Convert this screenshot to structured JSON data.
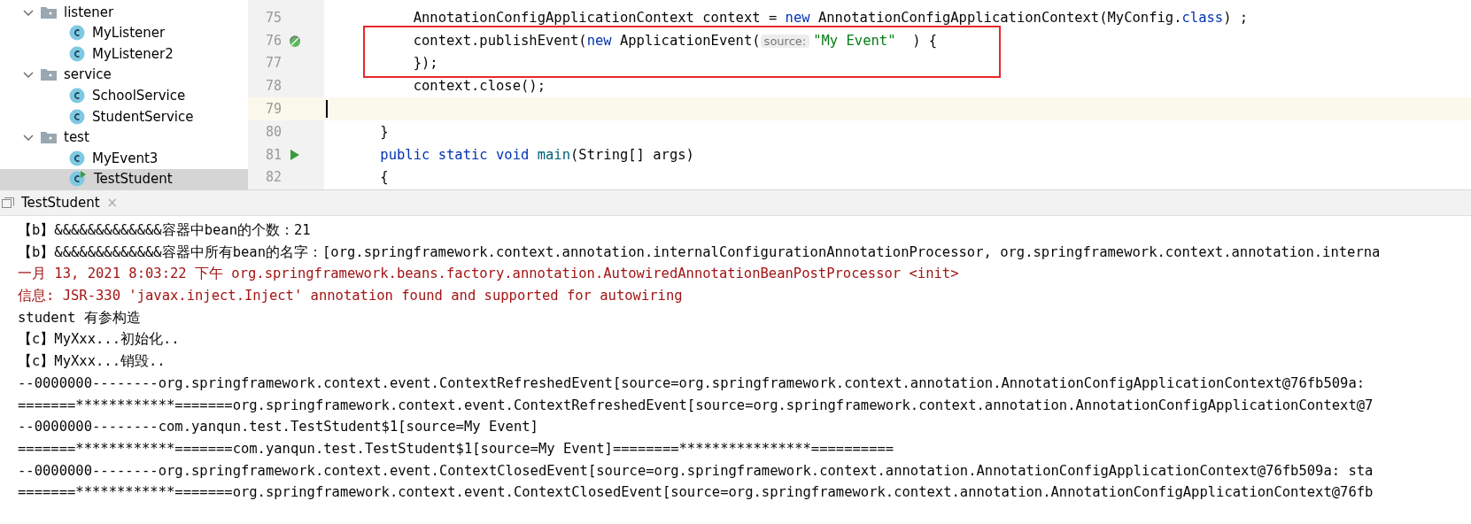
{
  "project_tree": {
    "items": [
      {
        "label": "listener",
        "kind": "folder",
        "expanded": true,
        "selected": false,
        "children": [
          {
            "label": "MyListener",
            "kind": "class",
            "selected": false
          },
          {
            "label": "MyListener2",
            "kind": "class",
            "selected": false
          }
        ]
      },
      {
        "label": "service",
        "kind": "folder",
        "expanded": true,
        "selected": false,
        "children": [
          {
            "label": "SchoolService",
            "kind": "class",
            "selected": false
          },
          {
            "label": "StudentService",
            "kind": "class",
            "selected": false
          }
        ]
      },
      {
        "label": "test",
        "kind": "folder",
        "expanded": true,
        "selected": false,
        "children": [
          {
            "label": "MyEvent3",
            "kind": "class",
            "selected": false
          },
          {
            "label": "TestStudent",
            "kind": "runnable",
            "selected": true
          }
        ]
      }
    ]
  },
  "editor": {
    "lines": [
      {
        "number": "75",
        "kind": "plain",
        "current": false,
        "highlighted": false,
        "tokens": [
          {
            "t": "        AnnotationConfigApplicationContext context = ",
            "kind": "plain"
          },
          {
            "t": "new",
            "kind": "keyword"
          },
          {
            "t": " AnnotationConfigApplicationContext(MyConfig.",
            "kind": "plain"
          },
          {
            "t": "class",
            "kind": "keyword"
          },
          {
            "t": ") ;",
            "kind": "plain"
          }
        ]
      },
      {
        "number": "76",
        "kind": "override",
        "current": false,
        "highlighted": true,
        "tokens": [
          {
            "t": "        context.publishEvent(",
            "kind": "plain"
          },
          {
            "t": "new",
            "kind": "keyword"
          },
          {
            "t": " ApplicationEvent(",
            "kind": "plain"
          },
          {
            "t": "source:",
            "kind": "hint"
          },
          {
            "t": "\"My Event\"",
            "kind": "string"
          },
          {
            "t": "  ) {",
            "kind": "plain"
          }
        ]
      },
      {
        "number": "77",
        "kind": "plain",
        "current": false,
        "highlighted": true,
        "tokens": [
          {
            "t": "        });",
            "kind": "plain"
          }
        ]
      },
      {
        "number": "78",
        "kind": "plain",
        "current": false,
        "highlighted": false,
        "tokens": [
          {
            "t": "        context.close();",
            "kind": "plain"
          }
        ]
      },
      {
        "number": "79",
        "kind": "plain",
        "current": true,
        "highlighted": false
      },
      {
        "number": "80",
        "kind": "plain",
        "current": false,
        "highlighted": false,
        "tokens": [
          {
            "t": "    }",
            "kind": "plain"
          }
        ]
      },
      {
        "number": "81",
        "kind": "run",
        "current": false,
        "highlighted": false,
        "tokens": [
          {
            "t": "    public static void ",
            "kind": "keyword"
          },
          {
            "t": "main",
            "kind": "method"
          },
          {
            "t": "(String[] args)",
            "kind": "plain"
          }
        ]
      },
      {
        "number": "82",
        "kind": "plain",
        "current": false,
        "highlighted": false,
        "tokens": [
          {
            "t": "    {",
            "kind": "plain"
          }
        ]
      }
    ]
  },
  "run_panel": {
    "tab": {
      "label": "TestStudent",
      "close": "×"
    },
    "lines": [
      {
        "text": "【b】&&&&&&&&&&&&&容器中bean的个数：21",
        "kind": "out"
      },
      {
        "text": "【b】&&&&&&&&&&&&&容器中所有bean的名字：[org.springframework.context.annotation.internalConfigurationAnnotationProcessor, org.springframework.context.annotation.interna",
        "kind": "out"
      },
      {
        "text": "一月 13, 2021 8:03:22 下午 org.springframework.beans.factory.annotation.AutowiredAnnotationBeanPostProcessor <init>",
        "kind": "err"
      },
      {
        "text": "信息: JSR-330 'javax.inject.Inject' annotation found and supported for autowiring",
        "kind": "err"
      },
      {
        "text": "student 有参构造",
        "kind": "out"
      },
      {
        "text": "【c】MyXxx...初始化..",
        "kind": "out"
      },
      {
        "text": "【c】MyXxx...销毁..",
        "kind": "out"
      },
      {
        "text": "--0000000--------org.springframework.context.event.ContextRefreshedEvent[source=org.springframework.context.annotation.AnnotationConfigApplicationContext@76fb509a:",
        "kind": "out"
      },
      {
        "text": "=======************=======org.springframework.context.event.ContextRefreshedEvent[source=org.springframework.context.annotation.AnnotationConfigApplicationContext@7",
        "kind": "out"
      },
      {
        "text": "--0000000--------com.yanqun.test.TestStudent$1[source=My Event]",
        "kind": "out"
      },
      {
        "text": "=======************=======com.yanqun.test.TestStudent$1[source=My Event]========****************==========",
        "kind": "out"
      },
      {
        "text": "--0000000--------org.springframework.context.event.ContextClosedEvent[source=org.springframework.context.annotation.AnnotationConfigApplicationContext@76fb509a: sta",
        "kind": "out"
      },
      {
        "text": "=======************=======org.springframework.context.event.ContextClosedEvent[source=org.springframework.context.annotation.AnnotationConfigApplicationContext@76fb",
        "kind": "out"
      }
    ]
  }
}
